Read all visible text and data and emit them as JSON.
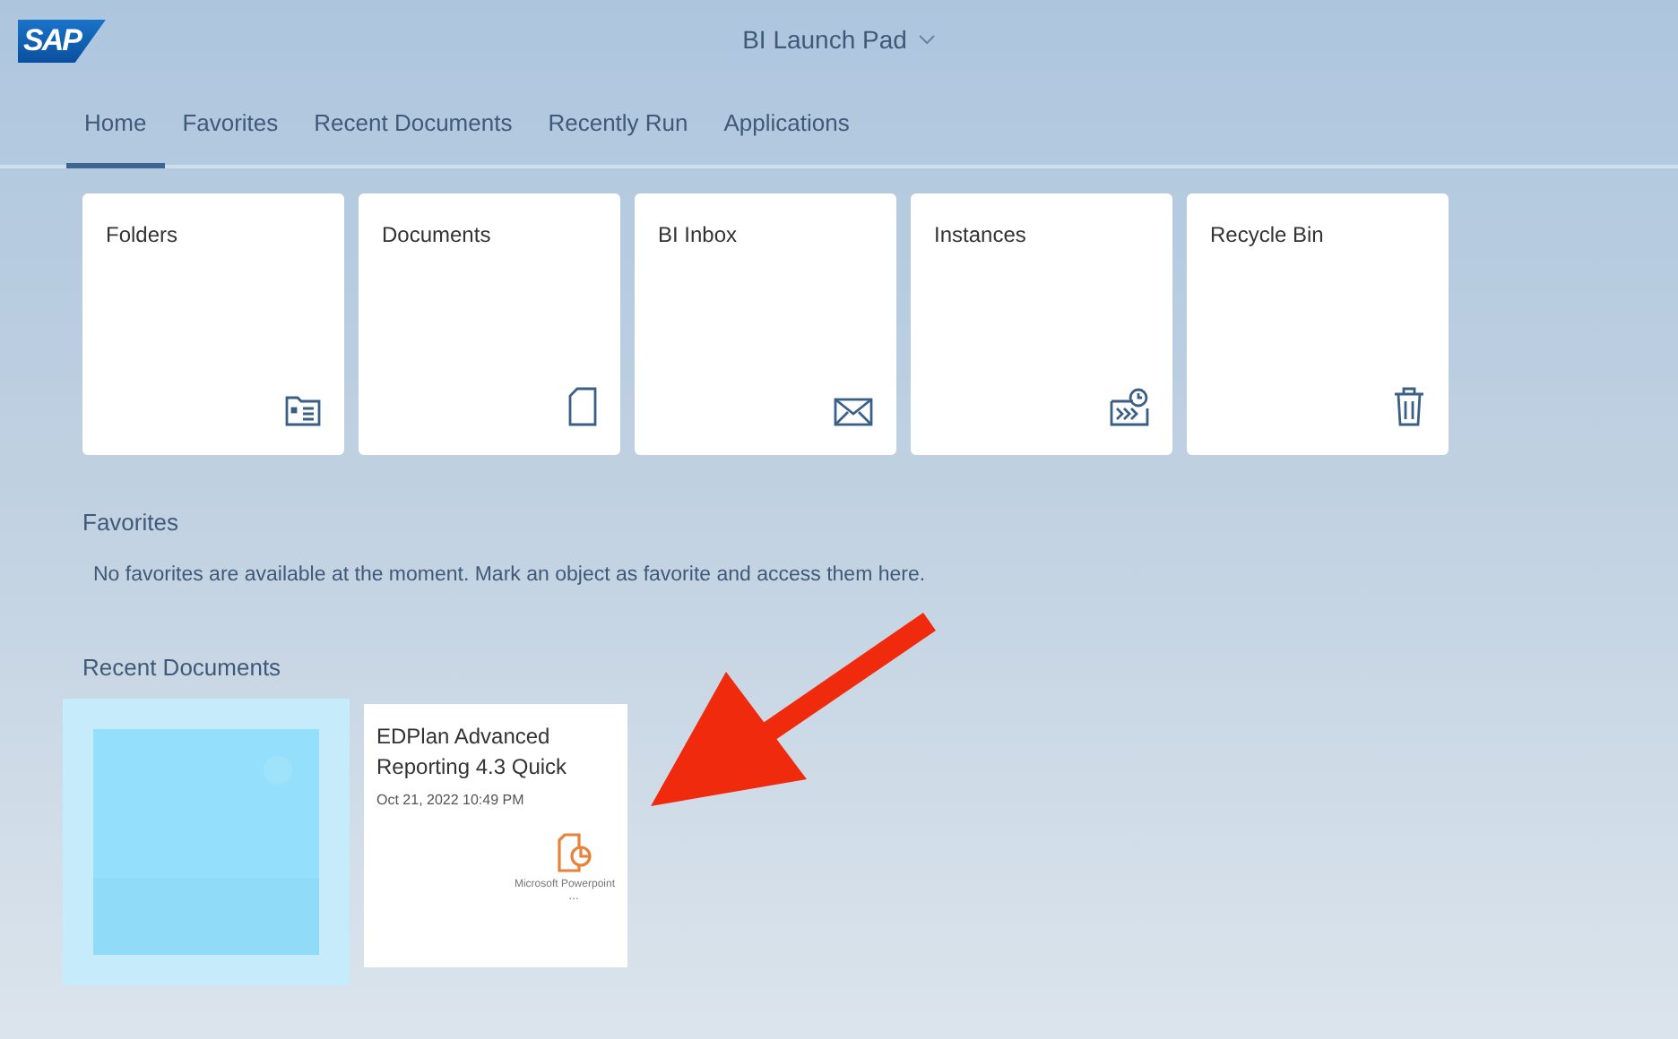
{
  "header": {
    "logo": "SAP",
    "title": "BI Launch Pad"
  },
  "tabs": [
    {
      "label": "Home",
      "selected": true
    },
    {
      "label": "Favorites",
      "selected": false
    },
    {
      "label": "Recent Documents",
      "selected": false
    },
    {
      "label": "Recently Run",
      "selected": false
    },
    {
      "label": "Applications",
      "selected": false
    }
  ],
  "tiles": [
    {
      "label": "Folders",
      "kind": "folder"
    },
    {
      "label": "Documents",
      "kind": "document"
    },
    {
      "label": "BI Inbox",
      "kind": "inbox"
    },
    {
      "label": "Instances",
      "kind": "instances"
    },
    {
      "label": "Recycle Bin",
      "kind": "trash"
    }
  ],
  "favorites": {
    "heading": "Favorites",
    "message": "No favorites are available at the moment. Mark an object as favorite and access them here."
  },
  "recent": {
    "heading": "Recent Documents",
    "items": [
      {
        "kind": "picture"
      },
      {
        "kind": "document",
        "title": "EDPlan Advanced Reporting 4.3 Quick",
        "date": "Oct 21, 2022 10:49 PM",
        "type": "Microsoft Powerpoint",
        "more": "..."
      }
    ]
  }
}
